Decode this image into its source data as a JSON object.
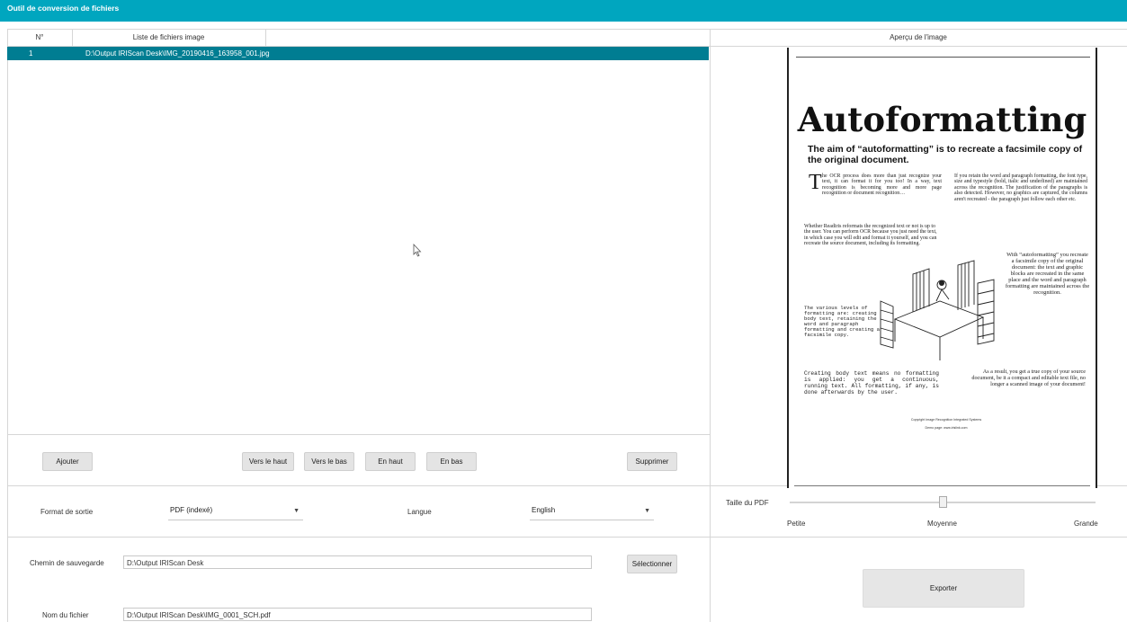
{
  "window": {
    "title": "Outil de conversion de fichiers"
  },
  "file_list": {
    "col_number": "N°",
    "col_files": "Liste de fichiers image",
    "rows": [
      {
        "number": "1",
        "path": "D:\\Output IRIScan Desk\\IMG_20190416_163958_001.jpg"
      }
    ]
  },
  "list_buttons": {
    "add": "Ajouter",
    "up": "Vers le haut",
    "down": "Vers le bas",
    "top": "En haut",
    "bottom": "En bas",
    "delete": "Supprimer"
  },
  "output": {
    "format_label": "Format de sortie",
    "format_value": "PDF (indexé)",
    "language_label": "Langue",
    "language_value": "English"
  },
  "save": {
    "path_label": "Chemin de sauvegarde",
    "path_value": "D:\\Output IRIScan Desk",
    "select_button": "Sélectionner",
    "filename_label": "Nom du fichier",
    "filename_value": "D:\\Output IRIScan Desk\\IMG_0001_SCH.pdf"
  },
  "preview": {
    "header": "Aperçu de l'image",
    "document": {
      "title": "Autoformatting",
      "subtitle": "The aim of “autoformatting” is to recreate a facsimile copy of the original document.",
      "dropcap": "T",
      "col1_para1": "he OCR process does more than just recognize your text, it can format it for you too! In a way, text recognition is becoming more and more page recognition or document recognition…",
      "col1_para2": "Whether Readiris reformats the recognized text or not is up to the user. You can perform OCR because you just need the text, in which case you will edit and format it yourself, and you can recreate the source document, including its formatting.",
      "col1_mono1": "The various levels of formatting are: creating body text, retaining the word and paragraph formatting and creating a facsimile copy.",
      "col1_mono2": "Creating body text means no formatting is applied: you get a continuous, running text. All formatting, if any, is done afterwards by the user.",
      "col2_para1": "If you retain the word and paragraph formatting, the font type, size and typestyle (bold, italic and underlined) are maintained across the recognition. The justification of the paragraphs is also detected. However, no graphics are captured, the columns aren't recreated - the paragraph just follow each other etc.",
      "col2_para2": "With “autoformatting” you recreate a facsimile copy of the original document: the text and graphic blocks are recreated in the same place and the word and paragraph formatting are maintained across the recognition.",
      "col2_para3": "As a result, you get a true copy of your source document, be it a compact and editable text file, no longer a scanned image of your document!",
      "footer1": "Copyright Image Recognition Integrated Systems",
      "footer2": "Demo page: www.irislink.com"
    }
  },
  "pdf_size": {
    "label": "Taille du PDF",
    "small": "Petite",
    "medium": "Moyenne",
    "large": "Grande",
    "level": 0.5
  },
  "export_button": "Exporter",
  "colors": {
    "titlebar": "#00a6bf",
    "selected_row": "#007d92"
  }
}
